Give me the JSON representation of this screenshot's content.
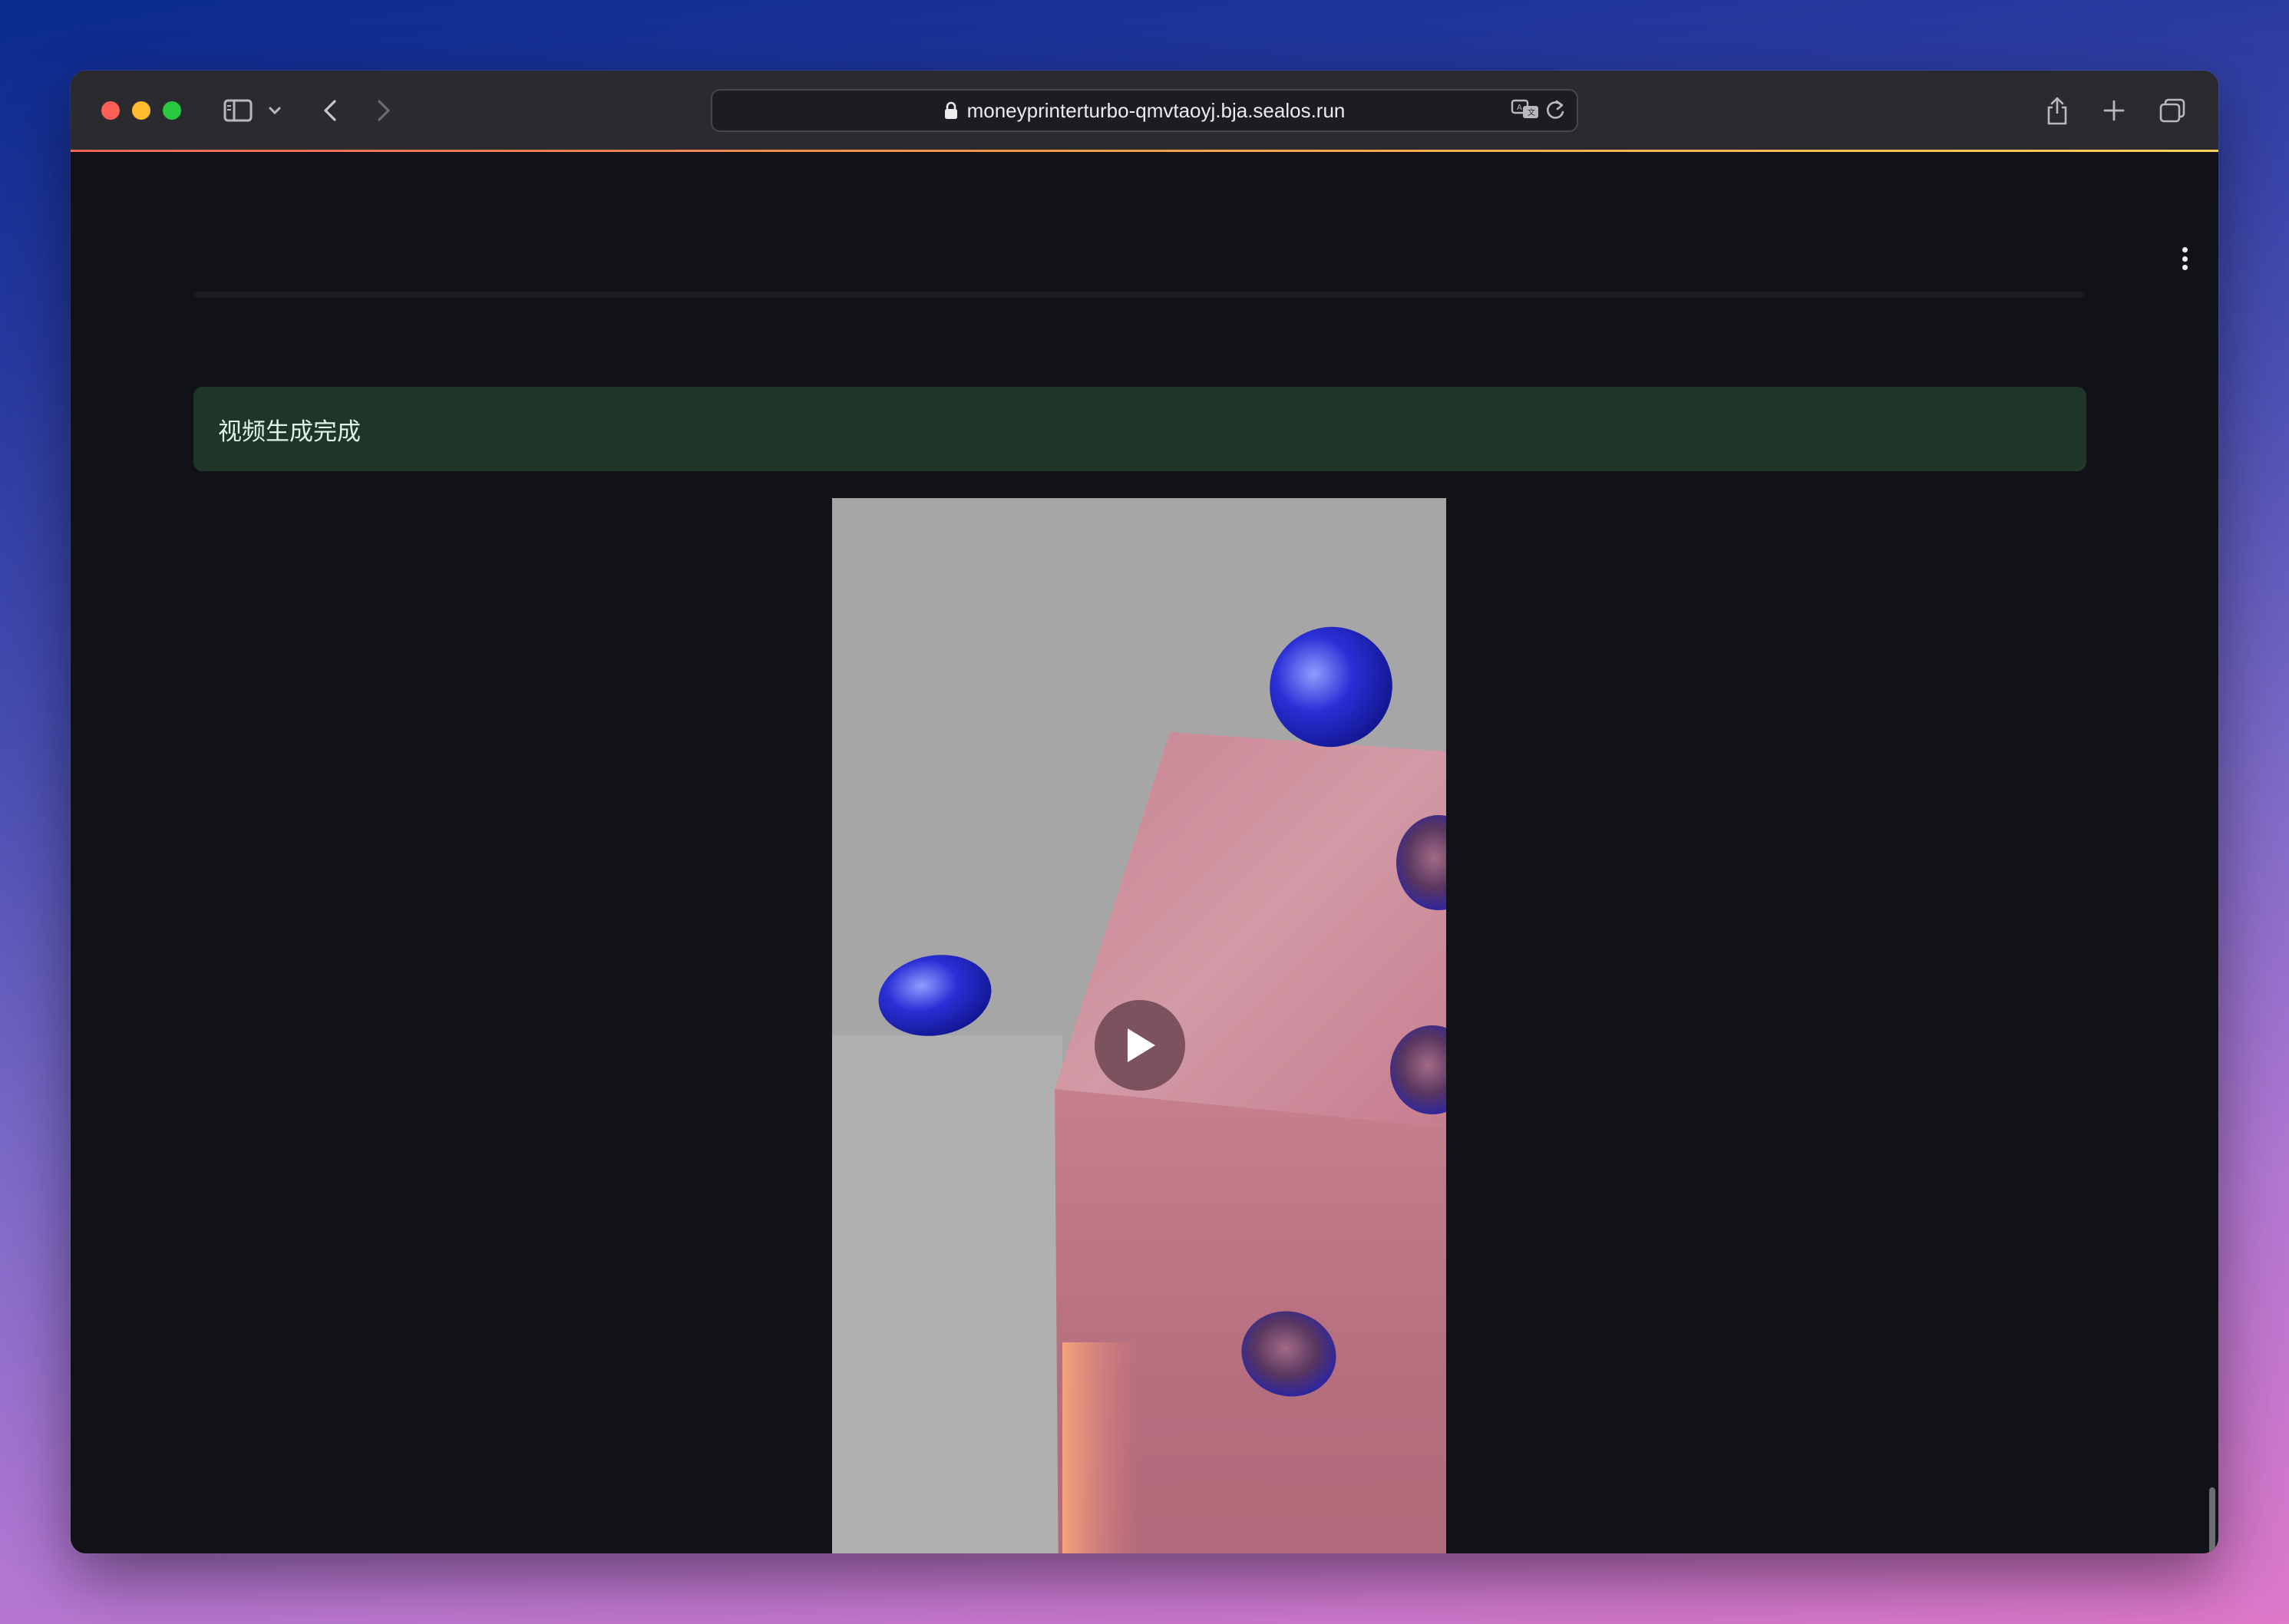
{
  "browser": {
    "url": "moneyprinterturbo-qmvtaoyj.bja.sealos.run",
    "icons": [
      "sidebar-icon",
      "chevron-down-icon",
      "back-icon",
      "forward-icon",
      "lock-icon",
      "translate-icon",
      "reload-icon",
      "share-icon",
      "new-tab-icon",
      "tab-overview-icon"
    ]
  },
  "page": {
    "status_message": "视频生成完成",
    "status_color": "#1d3628",
    "menu_icon": "kebab-menu-icon",
    "video": {
      "play_icon": "play-icon"
    }
  }
}
